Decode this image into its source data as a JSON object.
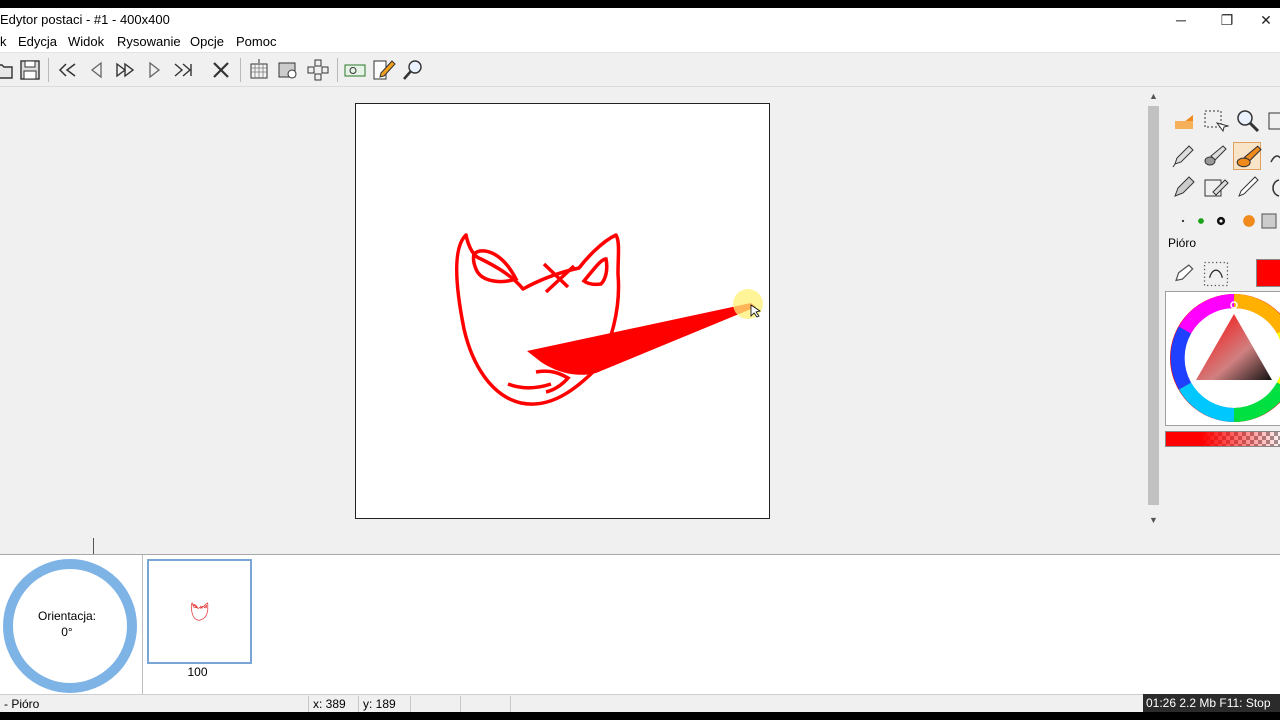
{
  "window": {
    "title": "Edytor postaci - #1 - 400x400",
    "minimize_glyph": "─",
    "restore_glyph": "❐",
    "close_glyph": "✕"
  },
  "menu": {
    "items": [
      {
        "label": "k"
      },
      {
        "label": "Edycja"
      },
      {
        "label": "Widok"
      },
      {
        "label": "Rysowanie"
      },
      {
        "label": "Opcje"
      },
      {
        "label": "Pomoc"
      }
    ]
  },
  "toolbar": {
    "icons": [
      "open-icon",
      "save-icon",
      "first-frame-icon",
      "prev-frame-icon",
      "play-icon",
      "next-frame-icon",
      "last-frame-icon",
      "delete-frame-icon",
      "canvas-grid-icon",
      "preview-icon",
      "crosshair-icon",
      "frame-view-icon",
      "pen-edit-icon",
      "zoom-tool-icon"
    ]
  },
  "right_panel": {
    "tool_label": "Pióro",
    "current_color": "#ff0000"
  },
  "bottom": {
    "orientation_label": "Orientacja:",
    "orientation_value": "0°",
    "frame_number": "100"
  },
  "status": {
    "tool": "- Pióro",
    "x": "x: 389",
    "y": "y: 189",
    "recorder": "01:26 2.2 Mb F11: Stop"
  },
  "colors": {
    "stroke": "#ff0000",
    "orientation_ring": "#7eb3e6",
    "frame_border": "#7aa6d6",
    "cursor_highlight": "#fff176"
  }
}
